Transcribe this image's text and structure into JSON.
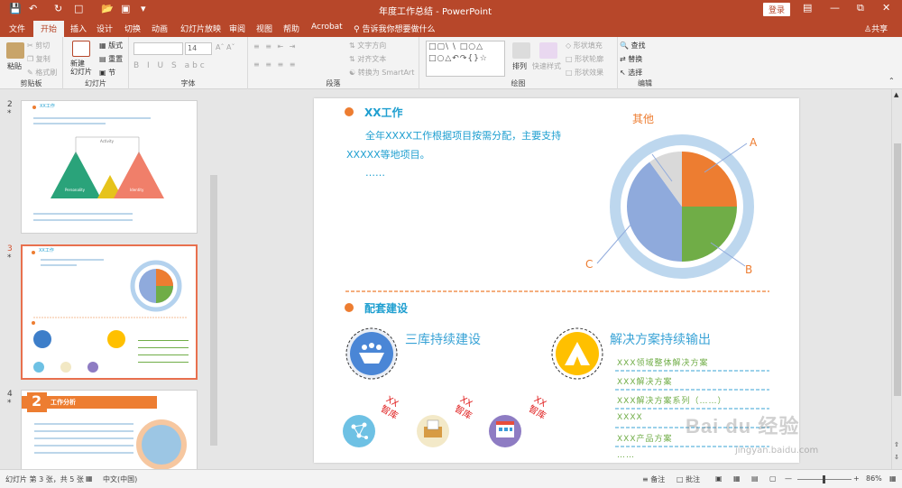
{
  "titlebar": {
    "title": "年度工作总结 - PowerPoint",
    "login": "登录",
    "save_icon": "save-icon",
    "undo_icon": "undo-icon"
  },
  "tabs": [
    "文件",
    "开始",
    "插入",
    "设计",
    "切换",
    "动画",
    "幻灯片放映",
    "审阅",
    "视图",
    "帮助",
    "Acrobat"
  ],
  "active_tab": "开始",
  "tell_me": "告诉我你想要做什么",
  "share": "共享",
  "ribbon": {
    "clipboard": {
      "paste": "粘贴",
      "cut": "剪切",
      "copy": "复制",
      "format_painter": "格式刷",
      "label": "剪贴板"
    },
    "slides": {
      "new_slide": "新建\n幻灯片",
      "layout": "版式",
      "reset": "重置",
      "section": "节",
      "label": "幻灯片"
    },
    "font": {
      "size": "14",
      "label": "字体"
    },
    "paragraph": {
      "text_direction": "文字方向",
      "align_text": "对齐文本",
      "convert_smartart": "转换为 SmartArt",
      "label": "段落"
    },
    "drawing": {
      "arrange": "排列",
      "quick_styles": "快速样式",
      "shape_fill": "形状填充",
      "shape_outline": "形状轮廓",
      "shape_effects": "形状效果",
      "label": "绘图"
    },
    "editing": {
      "find": "查找",
      "replace": "替换",
      "select": "选择",
      "label": "编辑"
    }
  },
  "thumbnails": [
    {
      "number": "2",
      "star": "*",
      "title": "XX工作",
      "labels": [
        "Personality",
        "Activity",
        "Identity"
      ]
    },
    {
      "number": "3",
      "star": "*",
      "title": "XX工作",
      "selected": true
    },
    {
      "number": "4",
      "star": "*",
      "title": "工作分析",
      "badge": "2"
    }
  ],
  "slide": {
    "section1_title": "XX工作",
    "body_text_line1": "全年XXXX工作根据项目按需分配，主要支持",
    "body_text_line2": "XXXXX等地项目。",
    "ellipsis": "……",
    "pie_labels": {
      "other": "其他",
      "a": "A",
      "b": "B",
      "c": "C"
    },
    "section2_title": "配套建设",
    "item1_title": "三库持续建设",
    "item2_title": "解决方案持续输出",
    "solution_list": [
      "XXX领域整体解决方案",
      "XXX解决方案",
      "XXX解决方案系列（……）",
      "XXXX",
      "XXX产品方案",
      "……"
    ],
    "xx_labels": [
      "XX\n智库",
      "XX\n智库",
      "XX\n智库"
    ]
  },
  "chart_data": {
    "type": "pie",
    "categories": [
      "A",
      "B",
      "C",
      "其他"
    ],
    "values": [
      25,
      25,
      40,
      10
    ],
    "colors": [
      "#ed7d31",
      "#70ad47",
      "#8faadc",
      "#d9d9d9"
    ]
  },
  "statusbar": {
    "slide_info": "幻灯片 第 3 张，共 5 张",
    "language": "中文(中国)",
    "notes": "备注",
    "comments": "批注",
    "zoom": "86%"
  },
  "watermark": {
    "main": "Bai du 经验",
    "sub": "jingyan.baidu.com"
  },
  "colors": {
    "accent": "#b7472a",
    "orange": "#ed7d31",
    "teal": "#3aa3d6",
    "green": "#70ad47",
    "blue": "#8faadc",
    "yellow": "#ffc000"
  }
}
